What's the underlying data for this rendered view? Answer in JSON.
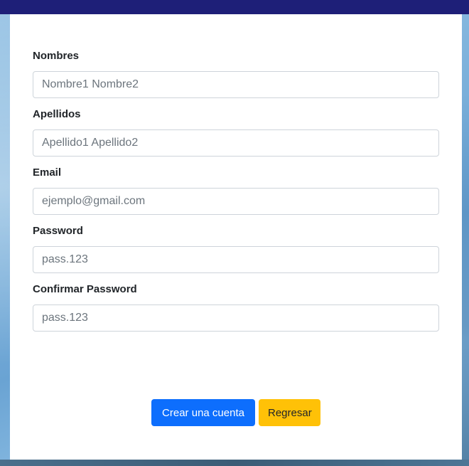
{
  "form": {
    "fields": [
      {
        "label": "Nombres",
        "placeholder": "Nombre1 Nombre2",
        "type": "text"
      },
      {
        "label": "Apellidos",
        "placeholder": "Apellido1 Apellido2",
        "type": "text"
      },
      {
        "label": "Email",
        "placeholder": "ejemplo@gmail.com",
        "type": "email"
      },
      {
        "label": "Password",
        "placeholder": "pass.123",
        "type": "password"
      },
      {
        "label": "Confirmar Password",
        "placeholder": "pass.123",
        "type": "password"
      }
    ]
  },
  "actions": {
    "create_label": "Crear una cuenta",
    "back_label": "Regresar"
  },
  "colors": {
    "topbar": "#1e1f78",
    "primary": "#0d6efd",
    "warning": "#ffc107"
  }
}
